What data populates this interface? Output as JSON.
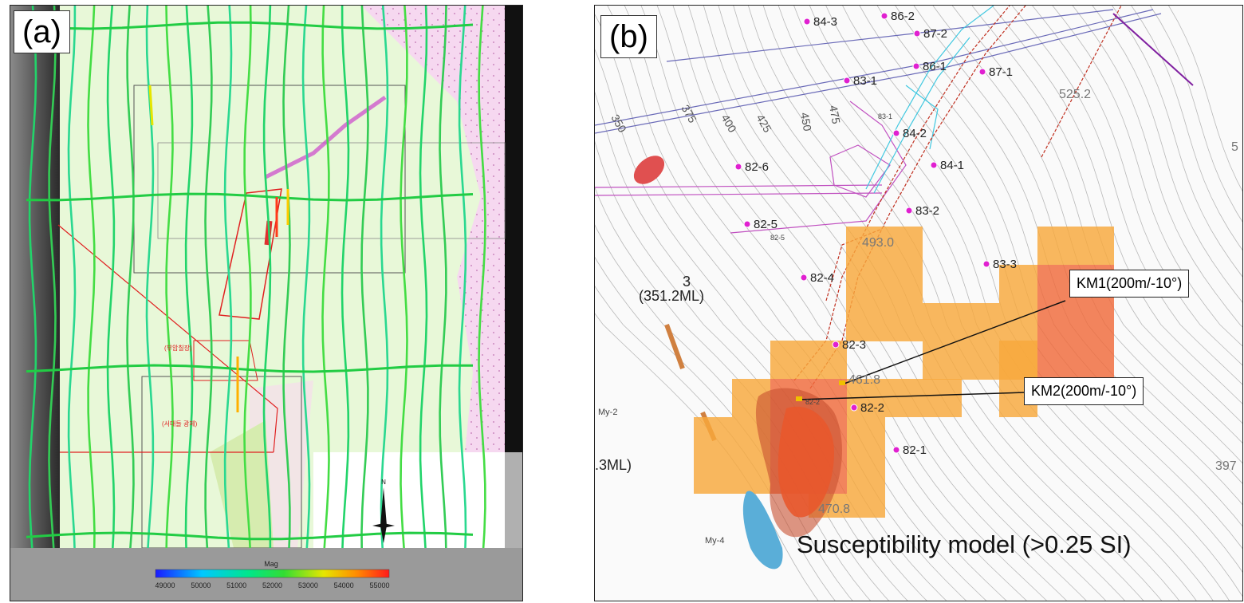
{
  "panel_a": {
    "tag": "(a)",
    "colorbar": {
      "title": "Mag",
      "ticks": [
        "49000",
        "50000",
        "51000",
        "52000",
        "53000",
        "54000",
        "55000"
      ],
      "colors": [
        "#1a1aff",
        "#00c8ff",
        "#00e68a",
        "#33dd33",
        "#e6e600",
        "#ff8c00",
        "#ff1a1a"
      ]
    },
    "map_labels": [
      "(부암칠장)",
      "(서대들 광체)"
    ],
    "north_label": "N"
  },
  "panel_b": {
    "tag": "(b)",
    "drillholes": [
      "84-3",
      "86-2",
      "87-2",
      "86-1",
      "87-1",
      "83-1",
      "84-2",
      "82-6",
      "84-1",
      "83-2",
      "82-5",
      "82-4",
      "83-3",
      "82-3",
      "82-2",
      "82-1"
    ],
    "elevations": [
      "525.2",
      "493.0",
      "461.8",
      "470.8",
      "397"
    ],
    "contour_labels": [
      "350",
      "375",
      "400",
      "425",
      "450",
      "475"
    ],
    "level_labels": [
      "3",
      "(351.2ML)",
      ".3ML)"
    ],
    "small_labels": [
      "My-2",
      "My-4",
      "82-5",
      "83-1",
      "82-2",
      "5"
    ],
    "callouts": {
      "km1": "KM1(200m/-10°)",
      "km2": "KM2(200m/-10°)"
    },
    "model_label": "Susceptibility model (>0.25 SI)",
    "colors": {
      "orange_block": "#f8a83c",
      "red_block": "#f06a3a",
      "body_red": "#e8582c",
      "body_blue": "#5aaed8",
      "drill_pink": "#e020d0"
    }
  }
}
